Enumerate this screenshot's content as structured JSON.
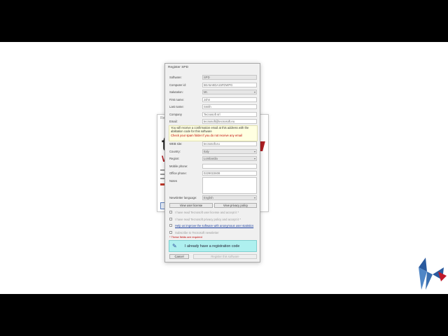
{
  "dialog": {
    "title": "Register SPD",
    "fields": [
      {
        "label": "Software:",
        "value": "SPD"
      },
      {
        "label": "Computer id:",
        "value": "5EA5A8DA15FDWPG"
      },
      {
        "label": "Salutation:",
        "value": "Mr."
      },
      {
        "label": "First name:",
        "value": "John"
      },
      {
        "label": "Last name:",
        "value": "Smith"
      },
      {
        "label": "Company",
        "value": "Tecnosoft srl"
      },
      {
        "label": "Email:",
        "value": "tecnosoft@tecnosoft.eu"
      }
    ],
    "notice_text": "You will receive a confirmation email at this address with the abilitation code for this software",
    "notice_warning": "Check your spam folder if you do not receive any email",
    "fields2": [
      {
        "label": "WEB site:",
        "value": "tecnosoft.eu"
      },
      {
        "label": "Country:",
        "value": "Italy"
      },
      {
        "label": "Region:",
        "value": "Lombardia"
      },
      {
        "label": "Mobile phone:",
        "value": ""
      },
      {
        "label": "Office phone:",
        "value": "0229022608"
      }
    ],
    "notes_label": "Notes",
    "newsletter_label": "Newsletter language:",
    "newsletter_value": "English",
    "view_license": "View user license",
    "view_privacy": "View privacy policy",
    "checks": [
      "I have read Tecnosoft user license and accept it *",
      "I have read Tecnosoft privacy policy and accept it *",
      "Help us improve the software with anonymous user statistics",
      "Subscribe to Tecnosoft newsletter"
    ],
    "required_note": "* These fields are required",
    "regcode_label": "I already have a registration code",
    "cancel": "Cancel",
    "register": "Register this software"
  },
  "background_window": {
    "title": "Re",
    "big_letter": "t",
    "red_letter": "W"
  },
  "colors": {
    "accent_red": "#b01f24",
    "regcode_bg": "#aef0ef",
    "link_blue": "#1a3fa0"
  }
}
